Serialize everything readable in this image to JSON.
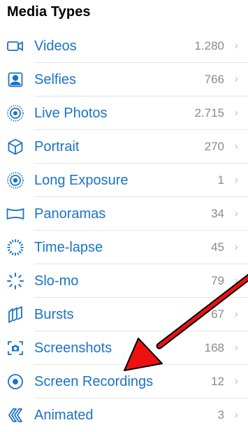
{
  "header": {
    "title": "Media Types"
  },
  "colors": {
    "accent": "#1a73c9",
    "count": "#8a8a8e",
    "annotation_arrow": "#ee1111"
  },
  "items": [
    {
      "label": "Videos",
      "count": "1.280",
      "icon": "video-icon"
    },
    {
      "label": "Selfies",
      "count": "766",
      "icon": "selfie-icon"
    },
    {
      "label": "Live Photos",
      "count": "2.715",
      "icon": "live-photo-icon"
    },
    {
      "label": "Portrait",
      "count": "270",
      "icon": "portrait-cube-icon"
    },
    {
      "label": "Long Exposure",
      "count": "1",
      "icon": "long-exposure-icon"
    },
    {
      "label": "Panoramas",
      "count": "34",
      "icon": "panorama-icon"
    },
    {
      "label": "Time-lapse",
      "count": "45",
      "icon": "time-lapse-icon"
    },
    {
      "label": "Slo-mo",
      "count": "79",
      "icon": "slo-mo-icon"
    },
    {
      "label": "Bursts",
      "count": "67",
      "icon": "bursts-icon"
    },
    {
      "label": "Screenshots",
      "count": "168",
      "icon": "screenshot-icon"
    },
    {
      "label": "Screen Recordings",
      "count": "12",
      "icon": "screen-recording-icon"
    },
    {
      "label": "Animated",
      "count": "3",
      "icon": "animated-icon"
    }
  ],
  "chevron": "›"
}
